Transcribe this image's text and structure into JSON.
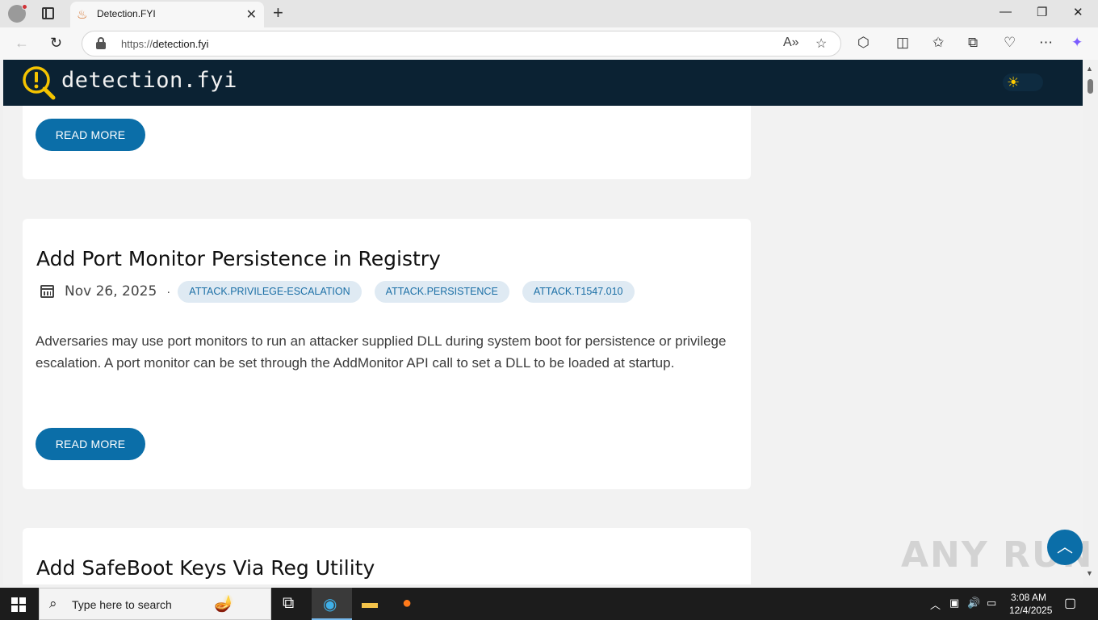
{
  "browser": {
    "tab_title": "Detection.FYI",
    "url_proto": "https://",
    "url_host": "detection.fyi",
    "icons": [
      "profile-icon",
      "tab-actions-icon",
      "close-icon",
      "new-tab-icon",
      "minimize-icon",
      "restore-icon",
      "window-close-icon",
      "back-icon",
      "refresh-icon",
      "lock-icon",
      "read-aloud-icon",
      "favorite-icon",
      "extensions-icon",
      "split-screen-icon",
      "favorites-icon",
      "collections-icon",
      "browser-essentials-icon",
      "more-icon",
      "copilot-icon"
    ]
  },
  "site": {
    "name": "detection.fyi",
    "accent": "#0b6ea8",
    "header_bg": "#0b2233"
  },
  "posts": [
    {
      "read_more": "READ MORE"
    },
    {
      "title": "Add Port Monitor Persistence in Registry",
      "date": "Nov 26, 2025",
      "separator": "·",
      "tags": [
        "ATTACK.PRIVILEGE-ESCALATION",
        "ATTACK.PERSISTENCE",
        "ATTACK.T1547.010"
      ],
      "excerpt": "Adversaries may use port monitors to run an attacker supplied DLL during system boot for persistence or privilege escalation. A port monitor can be set through the AddMonitor API call to set a DLL to be loaded at startup.",
      "read_more": "READ MORE"
    },
    {
      "title": "Add SafeBoot Keys Via Reg Utility"
    }
  ],
  "watermark": "ANY RUN",
  "taskbar": {
    "search_placeholder": "Type here to search",
    "time": "3:08 AM",
    "date": "12/4/2025"
  }
}
